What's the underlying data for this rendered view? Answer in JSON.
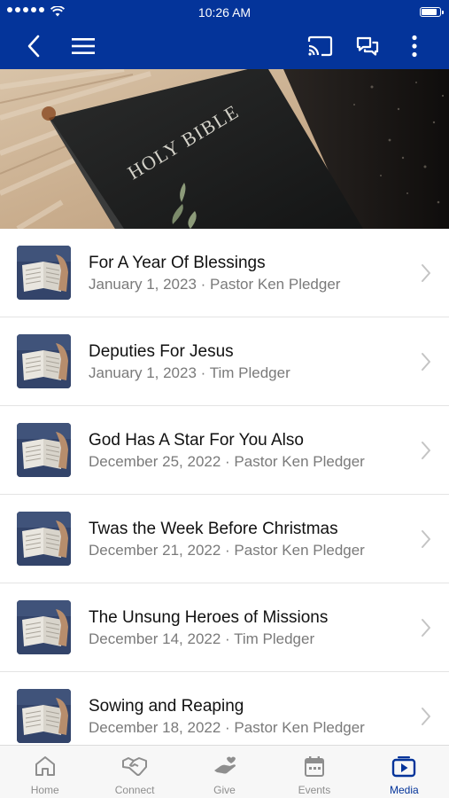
{
  "status_bar": {
    "time": "10:26 AM",
    "battery_level": 0.9
  },
  "colors": {
    "brand": "#04349a",
    "active_tab": "#04349a",
    "inactive": "#8e8e8e"
  },
  "header": {
    "icons": [
      "back-icon",
      "menu-icon",
      "cast-icon",
      "chat-icon",
      "more-icon"
    ]
  },
  "hero": {
    "book_title": "HOLY BIBLE"
  },
  "media_list": {
    "items": [
      {
        "title": "For A Year Of Blessings",
        "subtitle": "January 1, 2023 · Pastor Ken Pledger"
      },
      {
        "title": "Deputies For Jesus",
        "subtitle": "January 1, 2023 · Tim Pledger"
      },
      {
        "title": "God Has A Star For You Also",
        "subtitle": "December 25, 2022 · Pastor Ken Pledger"
      },
      {
        "title": "Twas the Week Before Christmas",
        "subtitle": "December 21, 2022 · Pastor Ken Pledger"
      },
      {
        "title": "The Unsung Heroes of Missions",
        "subtitle": "December 14, 2022 · Tim Pledger"
      },
      {
        "title": "Sowing and Reaping",
        "subtitle": "December 18, 2022 · Pastor Ken Pledger"
      }
    ]
  },
  "tabbar": {
    "tabs": [
      {
        "label": "Home",
        "icon": "home-icon",
        "active": false
      },
      {
        "label": "Connect",
        "icon": "handshake-icon",
        "active": false
      },
      {
        "label": "Give",
        "icon": "give-hand-icon",
        "active": false
      },
      {
        "label": "Events",
        "icon": "calendar-icon",
        "active": false
      },
      {
        "label": "Media",
        "icon": "media-play-icon",
        "active": true
      }
    ]
  }
}
